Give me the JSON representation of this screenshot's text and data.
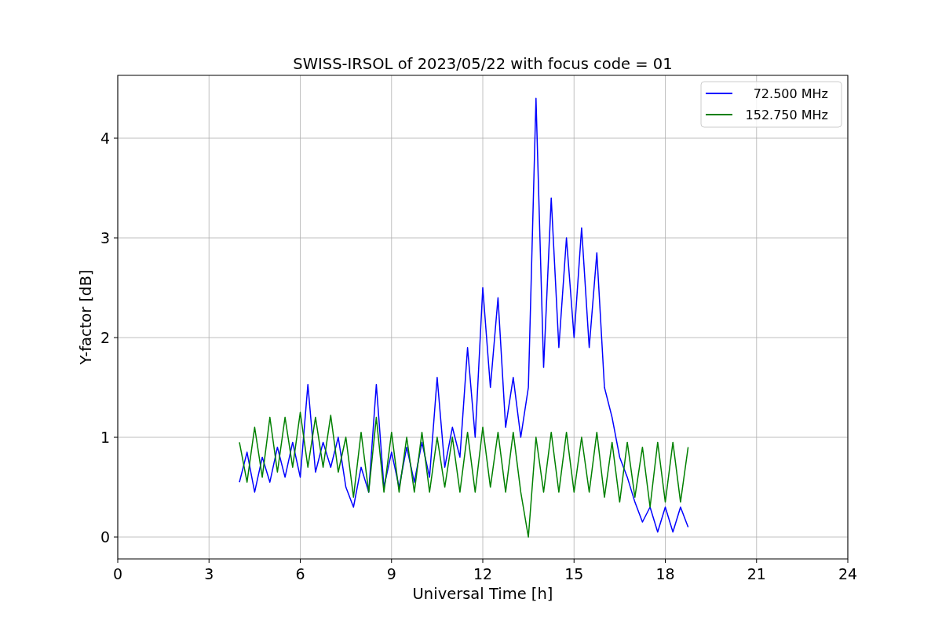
{
  "chart": {
    "chart_data": {
      "type": "line",
      "title": "SWISS-IRSOL of 2023/05/22 with focus code = 01",
      "xlabel": "Universal Time [h]",
      "ylabel": "Y-factor [dB]",
      "xlim": [
        0,
        24
      ],
      "ylim": [
        -0.22,
        4.63
      ],
      "xticks": [
        0,
        3,
        6,
        9,
        12,
        15,
        18,
        21,
        24
      ],
      "yticks": [
        0,
        1,
        2,
        3,
        4
      ],
      "grid": true,
      "legend": "upper right",
      "x": [
        4,
        4.25,
        4.5,
        4.75,
        5,
        5.25,
        5.5,
        5.75,
        6,
        6.25,
        6.5,
        6.75,
        7,
        7.25,
        7.5,
        7.75,
        8,
        8.25,
        8.5,
        8.75,
        9,
        9.25,
        9.5,
        9.75,
        10,
        10.25,
        10.5,
        10.75,
        11,
        11.25,
        11.5,
        11.75,
        12,
        12.25,
        12.5,
        12.75,
        13,
        13.25,
        13.5,
        13.75,
        14,
        14.25,
        14.5,
        14.75,
        15,
        15.25,
        15.5,
        15.75,
        16,
        16.25,
        16.5,
        16.75,
        17,
        17.25,
        17.5,
        17.75,
        18,
        18.25,
        18.5,
        18.75
      ],
      "series": [
        {
          "name": "72.500 MHz",
          "color": "#0000ff",
          "values": [
            0.55,
            0.85,
            0.45,
            0.8,
            0.55,
            0.9,
            0.6,
            0.95,
            0.6,
            1.53,
            0.65,
            0.95,
            0.7,
            1.0,
            0.5,
            0.3,
            0.7,
            0.45,
            1.53,
            0.5,
            0.85,
            0.5,
            0.9,
            0.55,
            0.95,
            0.6,
            1.6,
            0.7,
            1.1,
            0.8,
            1.9,
            1.0,
            2.5,
            1.5,
            2.4,
            1.1,
            1.6,
            1.0,
            1.5,
            4.4,
            1.7,
            3.4,
            1.9,
            3.0,
            2.0,
            3.1,
            1.9,
            2.85,
            1.5,
            1.2,
            0.8,
            0.6,
            0.35,
            0.15,
            0.3,
            0.05,
            0.3,
            0.05,
            0.3,
            0.1
          ]
        },
        {
          "name": "152.750 MHz",
          "color": "#008000",
          "values": [
            0.95,
            0.55,
            1.1,
            0.6,
            1.2,
            0.65,
            1.2,
            0.7,
            1.25,
            0.7,
            1.2,
            0.7,
            1.22,
            0.65,
            1.0,
            0.4,
            1.05,
            0.45,
            1.2,
            0.45,
            1.05,
            0.45,
            1.0,
            0.45,
            1.05,
            0.45,
            1.0,
            0.5,
            1.0,
            0.45,
            1.05,
            0.45,
            1.1,
            0.5,
            1.05,
            0.45,
            1.05,
            0.45,
            0.0,
            1.0,
            0.45,
            1.05,
            0.45,
            1.05,
            0.45,
            1.0,
            0.45,
            1.05,
            0.4,
            0.95,
            0.35,
            0.95,
            0.4,
            0.9,
            0.3,
            0.95,
            0.35,
            0.95,
            0.35,
            0.9
          ]
        }
      ]
    }
  }
}
